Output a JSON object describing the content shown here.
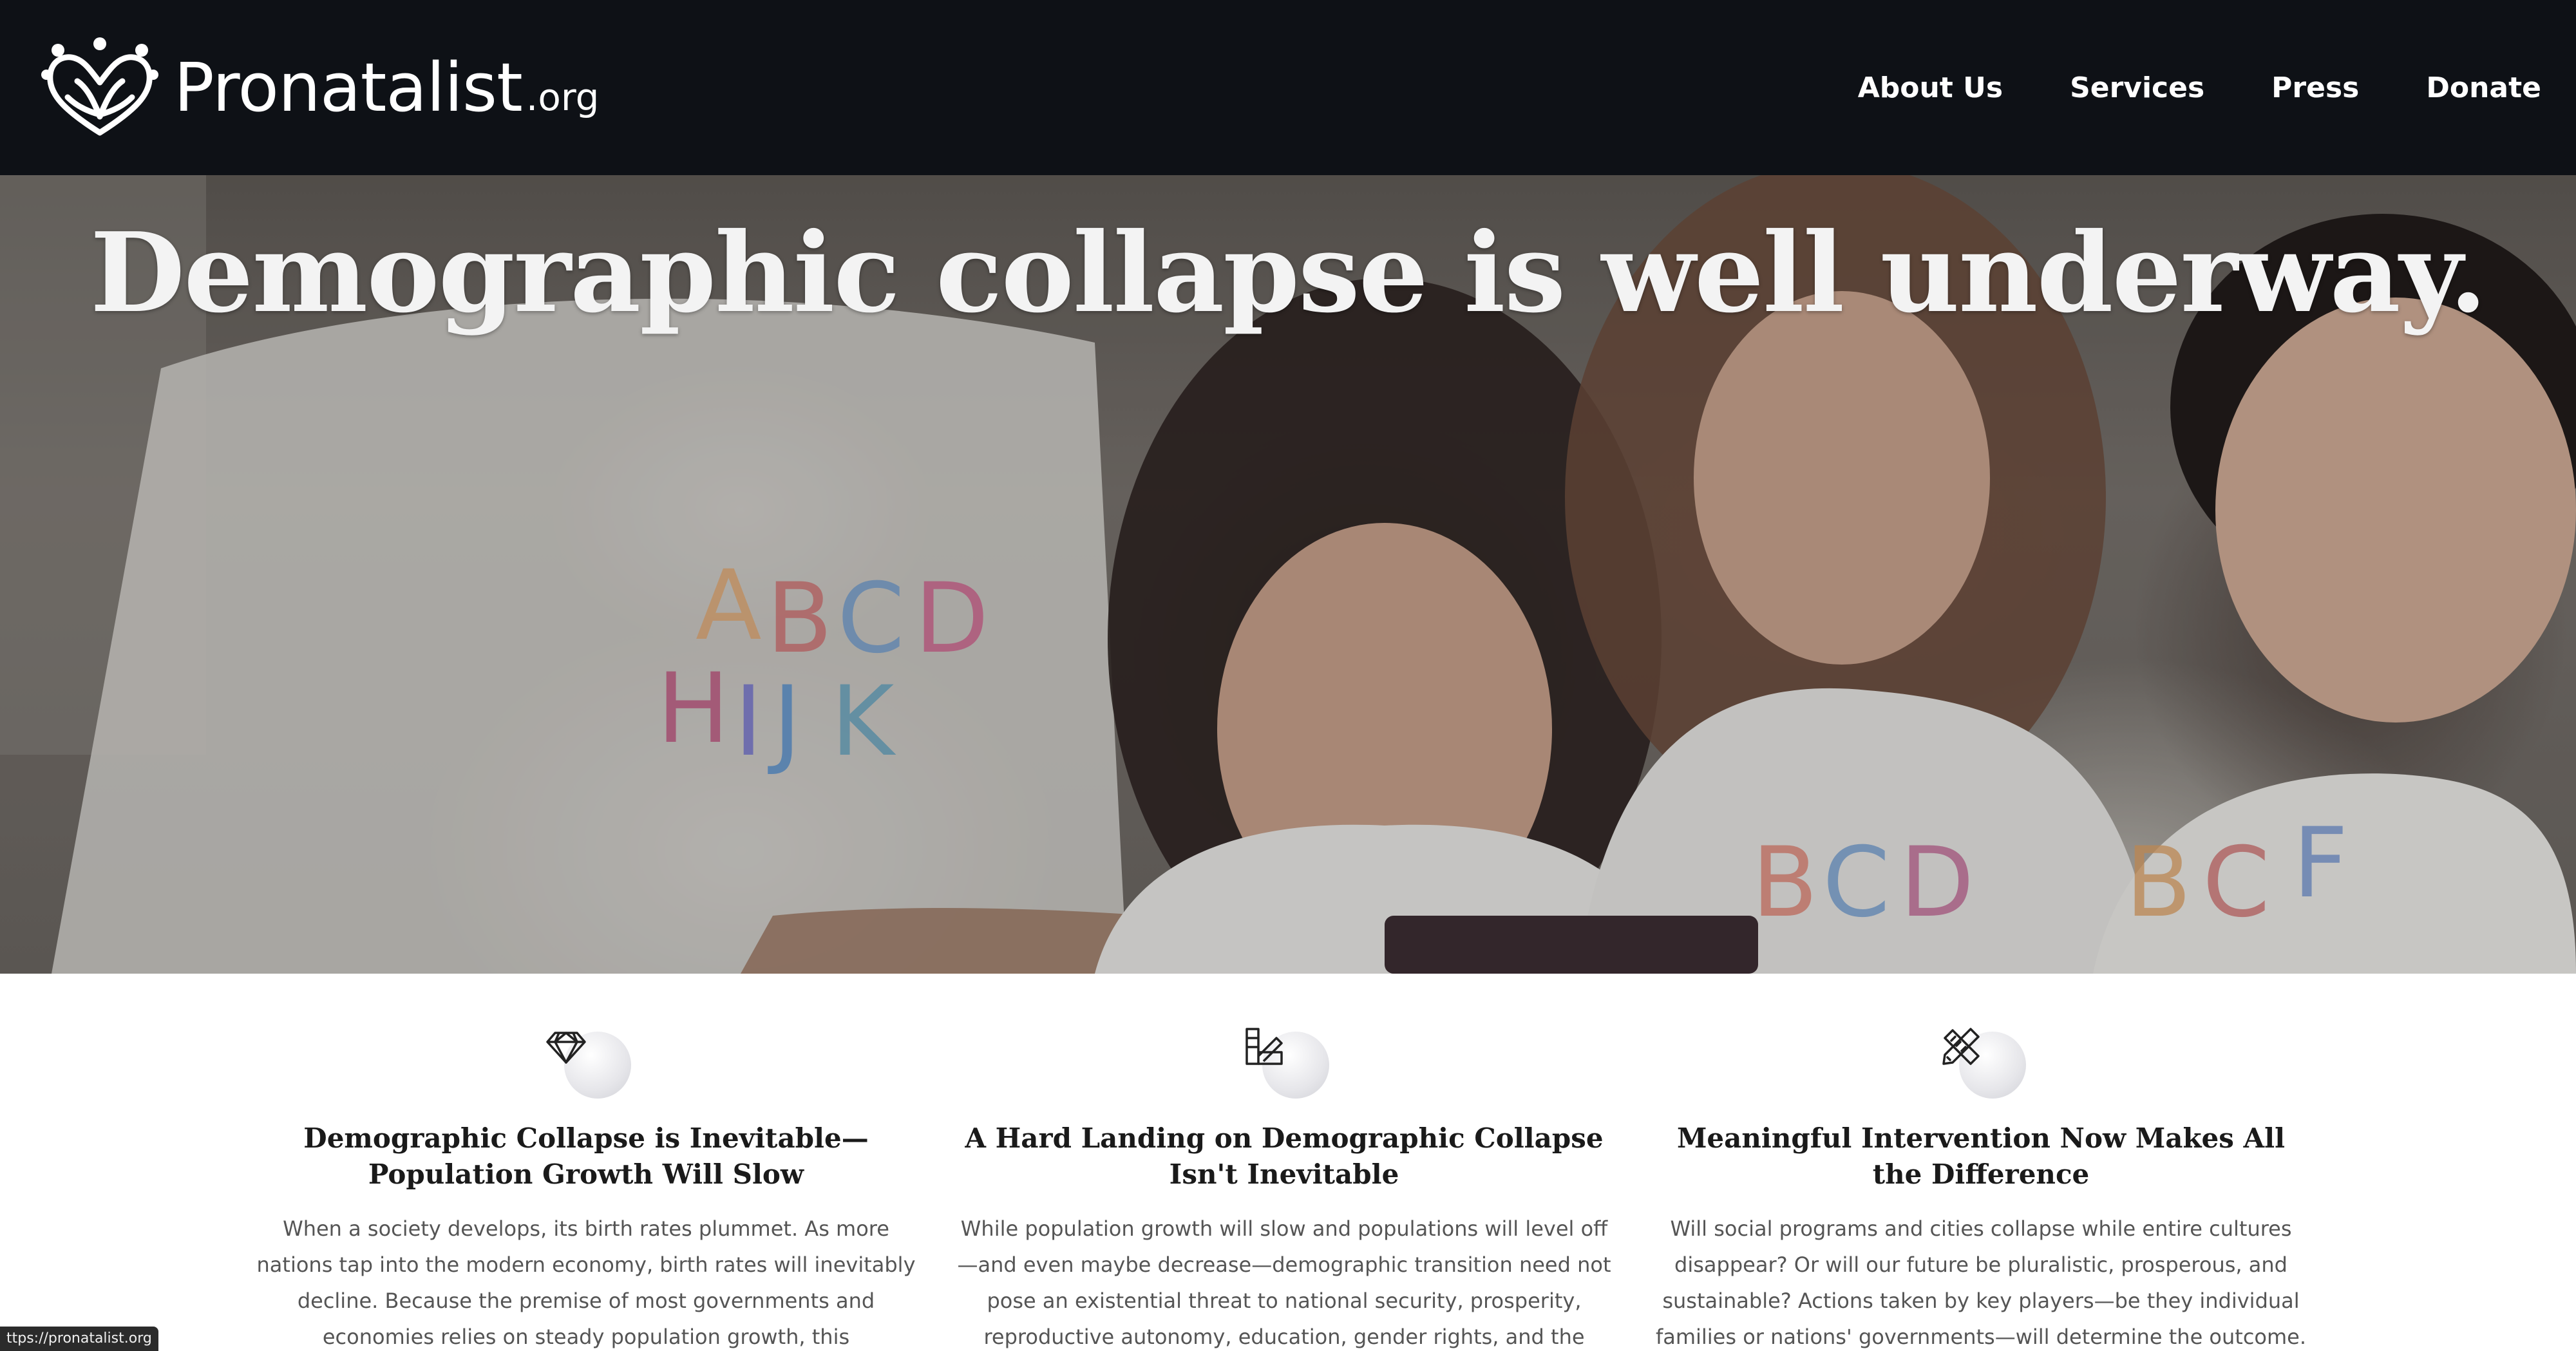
{
  "header": {
    "brand_name": "Pronatalist",
    "brand_tld": ".org",
    "nav": [
      "About Us",
      "Services",
      "Press",
      "Donate"
    ]
  },
  "hero": {
    "title": "Demographic collapse is well underway."
  },
  "features": [
    {
      "icon": "diamond-icon",
      "title": "Demographic Collapse is Inevitable—Population Growth Will Slow",
      "text": "When a society develops, its birth rates plummet. As more nations tap into the modern economy, birth rates will inevitably decline. Because the premise of most governments and economies relies on steady population growth, this demographic transition can cause serious"
    },
    {
      "icon": "palette-ruler-icon",
      "title": "A Hard Landing on Demographic Collapse Isn't Inevitable",
      "text": "While population growth will slow and populations will level off—and even maybe decrease—demographic transition need not pose an existential threat to national security, prosperity, reproductive autonomy, education, gender rights, and the future of low-birth-rate"
    },
    {
      "icon": "pencil-ruler-icon",
      "title": "Meaningful Intervention Now Makes All the Difference",
      "text": "Will social programs and cities collapse while entire cultures disappear? Or will our future be pluralistic, prosperous, and sustainable? Actions taken by key players—be they individual families or nations' governments—will determine the outcome."
    }
  ],
  "status_bar": {
    "url": "ttps://pronatalist.org"
  }
}
